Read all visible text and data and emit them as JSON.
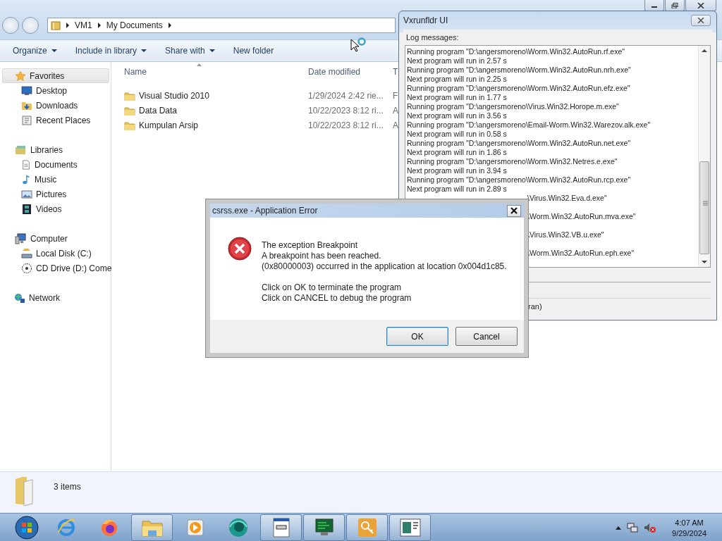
{
  "explorer": {
    "breadcrumbs": [
      "VM1",
      "My Documents"
    ],
    "toolbar": [
      {
        "label": "Organize",
        "dropdown": true
      },
      {
        "label": "Include in library",
        "dropdown": true
      },
      {
        "label": "Share with",
        "dropdown": true
      },
      {
        "label": "New folder",
        "dropdown": false
      }
    ],
    "sidebar": [
      {
        "label": "Favorites",
        "selected": true,
        "children": [
          {
            "label": "Desktop",
            "selected": false
          },
          {
            "label": "Downloads",
            "selected": false
          },
          {
            "label": "Recent Places",
            "selected": false
          }
        ]
      },
      {
        "label": "Libraries",
        "selected": false,
        "children": [
          {
            "label": "Documents",
            "selected": false
          },
          {
            "label": "Music",
            "selected": false
          },
          {
            "label": "Pictures",
            "selected": false
          },
          {
            "label": "Videos",
            "selected": false
          }
        ]
      },
      {
        "label": "Computer",
        "selected": false,
        "children": [
          {
            "label": "Local Disk (C:)",
            "selected": false
          },
          {
            "label": "CD Drive (D:) Come",
            "selected": false
          }
        ]
      },
      {
        "label": "Network",
        "selected": false
      }
    ],
    "columns": [
      "Name",
      "Date modified",
      "T"
    ],
    "rows": [
      {
        "name": "Visual Studio 2010",
        "date_modified": "1/29/2024 2:42 rie...",
        "column_3": "F"
      },
      {
        "name": "Data Data",
        "date_modified": "10/22/2023 8:12 ri...",
        "column_3": "A"
      },
      {
        "name": "Kumpulan Arsip",
        "date_modified": "10/22/2023 8:12 ri...",
        "column_3": "A"
      }
    ],
    "status": "3 items"
  },
  "log_window": {
    "title": "Vxrunfldr UI",
    "label": "Log messages:",
    "lines": [
      {
        "text": "Running program \"D:\\angersmoreno\\Worm.Win32.AutoRun.rf.exe\"",
        "kind": "full"
      },
      {
        "text": "Next program will run in 2.57 s",
        "kind": "full"
      },
      {
        "text": "Running program \"D:\\angersmoreno\\Worm.Win32.AutoRun.nrh.exe\"",
        "kind": "full"
      },
      {
        "text": "Next program will run in 2.25 s",
        "kind": "full"
      },
      {
        "text": "Running program \"D:\\angersmoreno\\Worm.Win32.AutoRun.efz.exe\"",
        "kind": "full"
      },
      {
        "text": "Next program will run in 1.77 s",
        "kind": "full"
      },
      {
        "text": "Running program \"D:\\angersmoreno\\Virus.Win32.Horope.m.exe\"",
        "kind": "full"
      },
      {
        "text": "Next program will run in 3.56 s",
        "kind": "full"
      },
      {
        "text": "Running program \"D:\\angersmoreno\\Email-Worm.Win32.Warezov.alk.exe\"",
        "kind": "full"
      },
      {
        "text": "Next program will run in 0.58 s",
        "kind": "full"
      },
      {
        "text": "Running program \"D:\\angersmoreno\\Worm.Win32.AutoRun.net.exe\"",
        "kind": "full"
      },
      {
        "text": "Next program will run in 1.86 s",
        "kind": "full"
      },
      {
        "text": "Running program \"D:\\angersmoreno\\Worm.Win32.Netres.e.exe\"",
        "kind": "full"
      },
      {
        "text": "Next program will run in 3.94 s",
        "kind": "full"
      },
      {
        "text": "Running program \"D:\\angersmoreno\\Worm.Win32.AutoRun.rcp.exe\"",
        "kind": "full"
      },
      {
        "text": "Next program will run in 2.89 s",
        "kind": "full"
      },
      {
        "text": "\\Virus.Win32.Eva.d.exe\"",
        "kind": "partial"
      },
      {
        "text": "\\Worm.Win32.AutoRun.mva.exe\"",
        "kind": "partial"
      },
      {
        "text": "\\Virus.Win32.VB.u.exe\"",
        "kind": "partial"
      },
      {
        "text": "\\Worm.Win32.AutoRun.eph.exe\"",
        "kind": "partial"
      }
    ],
    "footer": "ran)"
  },
  "dialog": {
    "title": "csrss.exe - Application Error",
    "message": "The exception Breakpoint\nA breakpoint has been reached.\n (0x80000003) occurred in the application at location 0x004d1c85.",
    "instructions": "Click on OK to terminate the program\nClick on CANCEL to debug the program",
    "buttons": [
      "OK",
      "Cancel"
    ]
  },
  "taskbar": {
    "apps": [
      {
        "running": false
      },
      {
        "running": false
      },
      {
        "running": true
      },
      {
        "running": false
      },
      {
        "running": false
      },
      {
        "running": true
      },
      {
        "running": true
      },
      {
        "running": true
      },
      {
        "running": true
      }
    ],
    "time": "4:07 AM",
    "date": "9/29/2024"
  }
}
